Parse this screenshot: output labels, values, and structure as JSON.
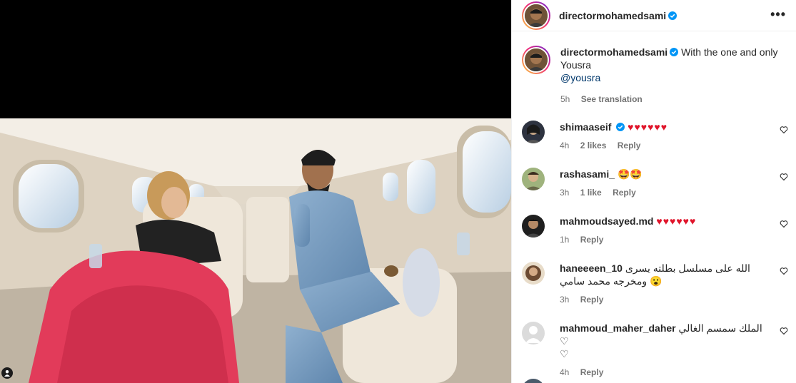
{
  "post": {
    "author": "directormohamedsami",
    "more_icon": "•••"
  },
  "caption": {
    "author": "directormohamedsami",
    "text_line1": "With the one and only",
    "text_line2": "Yousra",
    "mention": "@yousra",
    "time": "5h",
    "see_translation": "See translation"
  },
  "comments": [
    {
      "user": "shimaaseif",
      "verified": true,
      "text": "♥♥♥♥♥♥",
      "time": "4h",
      "likes": "2 likes",
      "reply": "Reply"
    },
    {
      "user": "rashasami_",
      "verified": false,
      "text": "🤩🤩",
      "time": "3h",
      "likes": "1 like",
      "reply": "Reply"
    },
    {
      "user": "mahmoudsayed.md",
      "verified": false,
      "text": "♥♥♥♥♥♥",
      "time": "1h",
      "likes": "",
      "reply": "Reply"
    },
    {
      "user": "haneeeen_10",
      "verified": false,
      "text": "الله على مسلسل بطلته يسرى",
      "text2": "ومخرجه محمد سامي 😮",
      "time": "3h",
      "likes": "",
      "reply": "Reply"
    },
    {
      "user": "mahmoud_maher_daher",
      "verified": false,
      "text": "الملك سمسم الغالي ♡",
      "text2": "♡",
      "time": "4h",
      "likes": "",
      "reply": "Reply"
    }
  ],
  "colors": {
    "verified": "#0095f6",
    "heart": "#e0142a",
    "link": "#00376b",
    "muted": "#737373"
  }
}
